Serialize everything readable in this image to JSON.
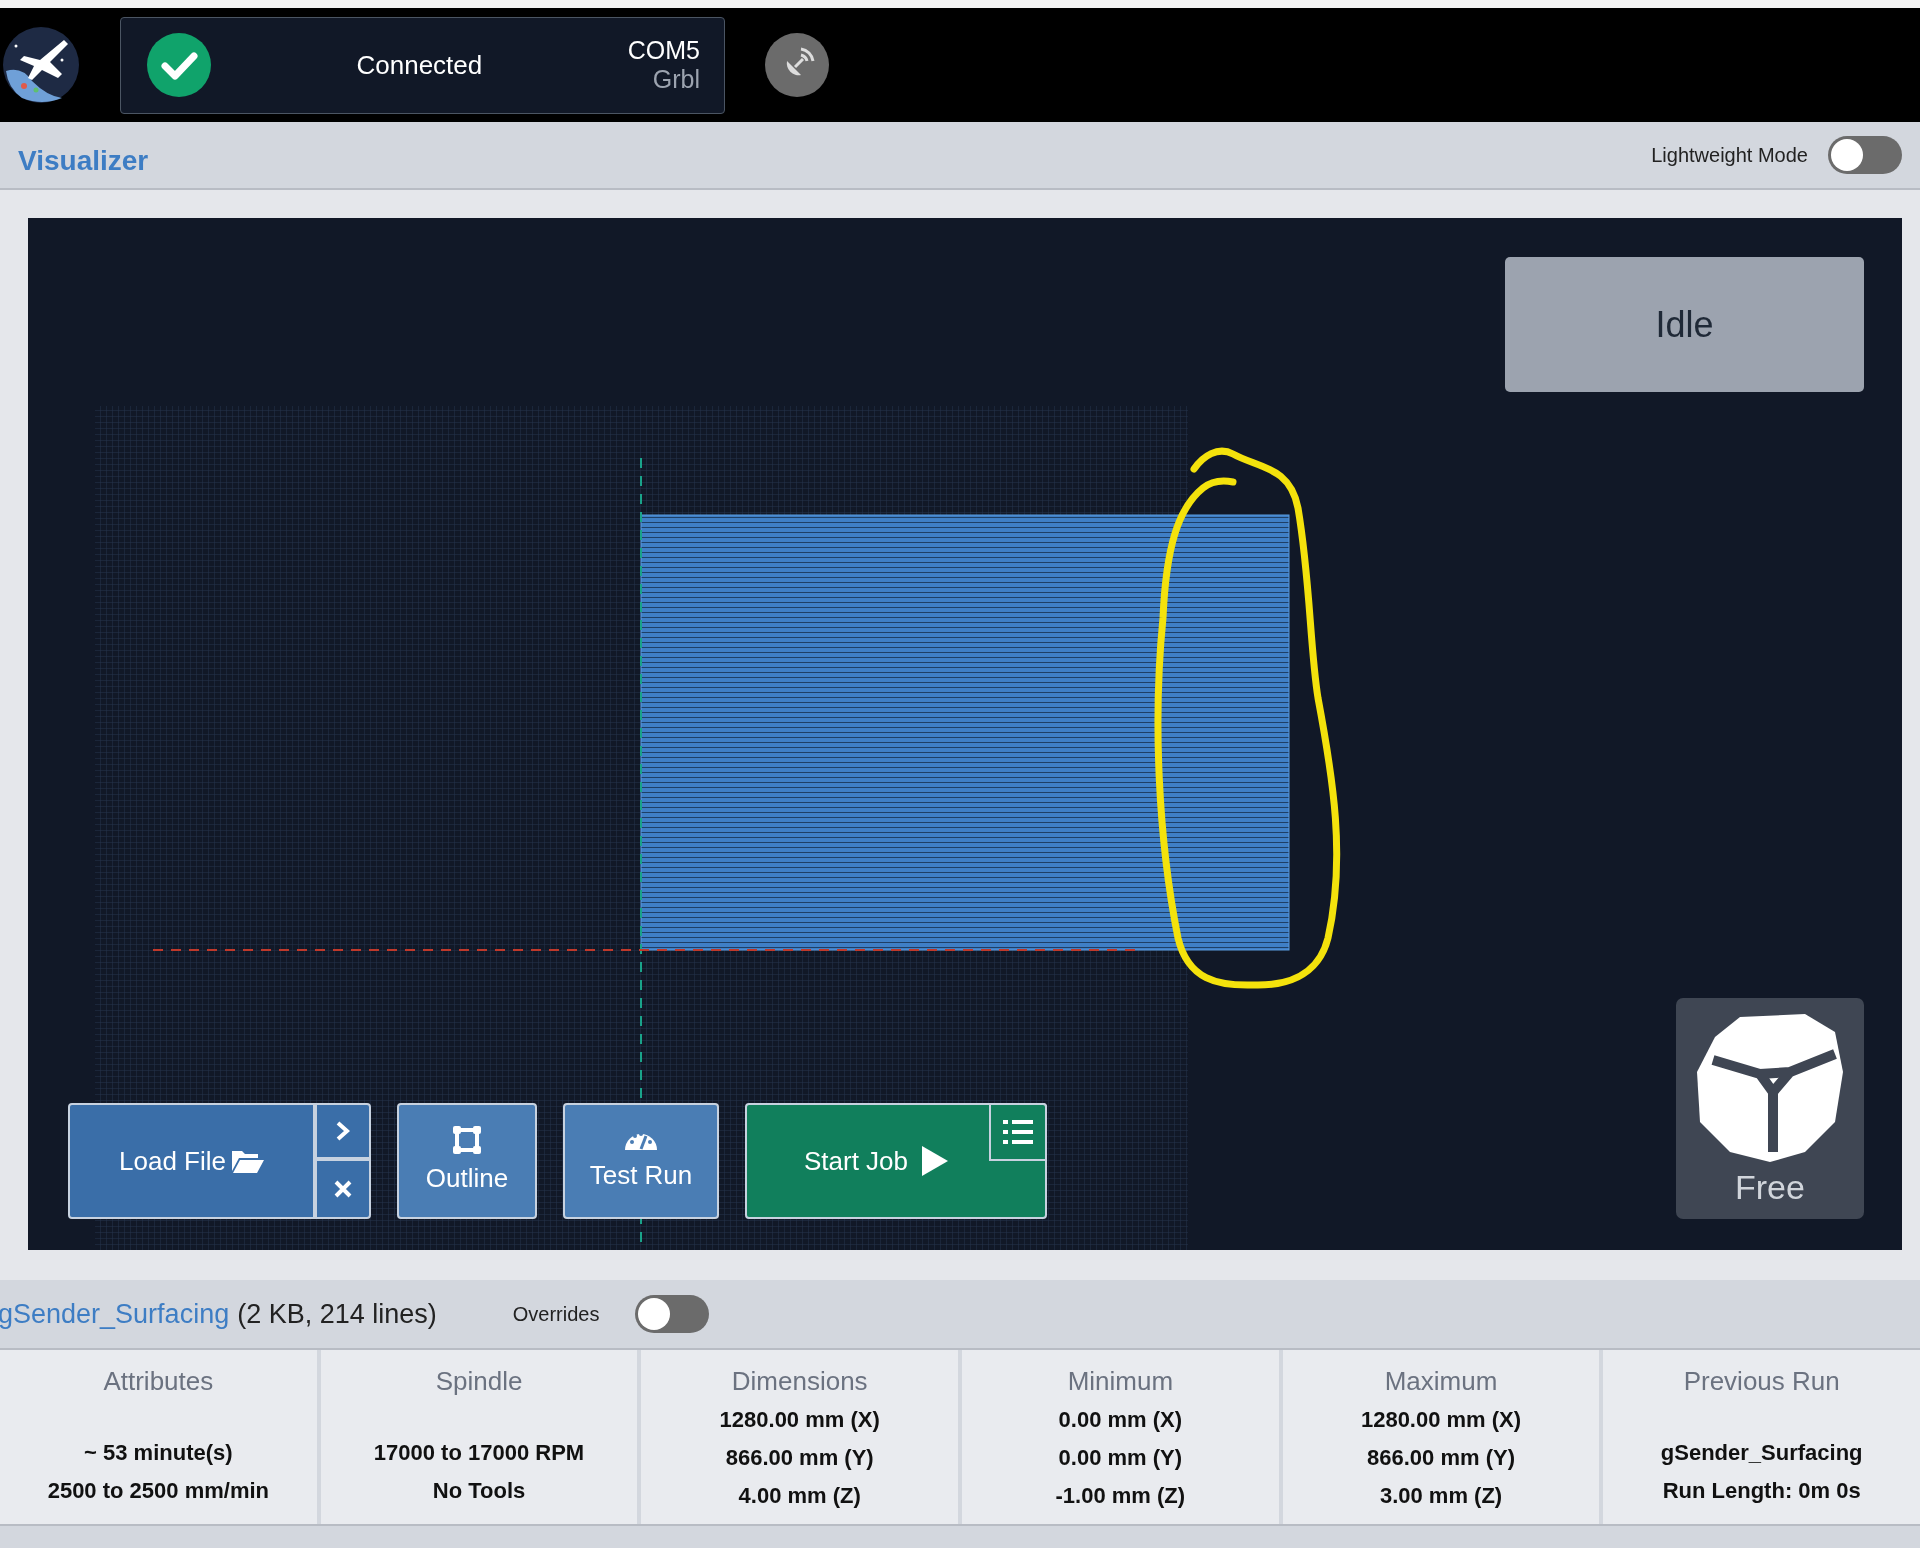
{
  "header": {
    "connection": {
      "status": "Connected",
      "connected": true,
      "port": "COM5",
      "firmware": "Grbl"
    }
  },
  "visualizer": {
    "title": "Visualizer",
    "lightweight_mode": {
      "label": "Lightweight Mode",
      "on": false
    },
    "state": "Idle",
    "camera": {
      "label": "Free"
    },
    "buttons": [
      {
        "kind": "load",
        "label": "Load File"
      },
      {
        "kind": "outline",
        "label": "Outline"
      },
      {
        "kind": "test",
        "label": "Test Run"
      },
      {
        "kind": "start",
        "label": "Start Job"
      }
    ]
  },
  "file": {
    "name": "gSender_Surfacing",
    "info": "(2 KB, 214 lines)",
    "overrides": {
      "label": "Overrides",
      "on": false
    }
  },
  "stats": [
    {
      "title": "Attributes",
      "lines": [
        "~ 53 minute(s)",
        "2500 to 2500 mm/min"
      ]
    },
    {
      "title": "Spindle",
      "lines": [
        "17000 to 17000 RPM",
        "No Tools"
      ]
    },
    {
      "title": "Dimensions",
      "lines": [
        "1280.00 mm (X)",
        "866.00 mm (Y)",
        "4.00 mm (Z)"
      ]
    },
    {
      "title": "Minimum",
      "lines": [
        "0.00 mm (X)",
        "0.00 mm (Y)",
        "-1.00 mm (Z)"
      ]
    },
    {
      "title": "Maximum",
      "lines": [
        "1280.00 mm (X)",
        "866.00 mm (Y)",
        "3.00 mm (Z)"
      ]
    },
    {
      "title": "Previous Run",
      "lines": [
        "gSender_Surfacing",
        "Run Length: 0m 0s"
      ]
    }
  ]
}
